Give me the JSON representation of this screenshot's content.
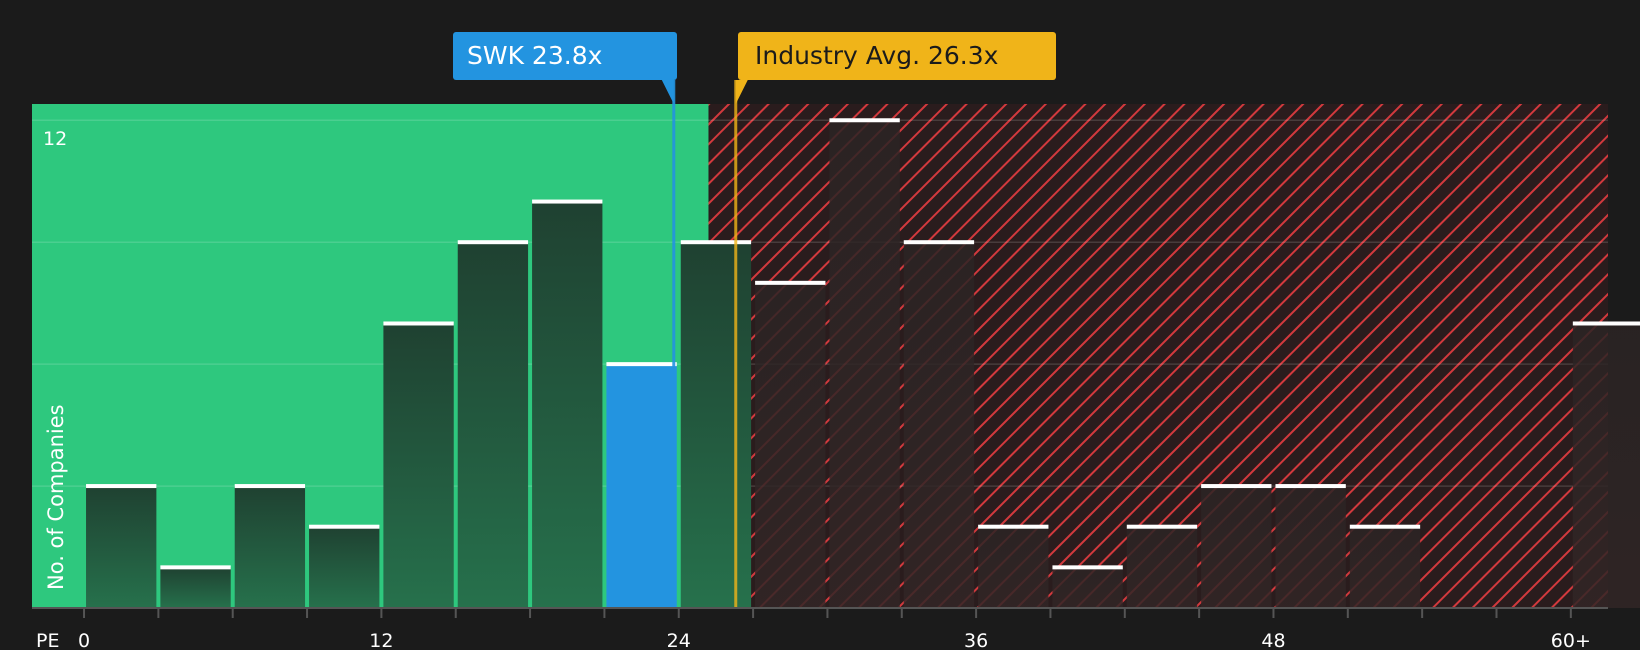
{
  "chart_data": {
    "type": "bar",
    "xlabel": "PE",
    "ylabel": "No. of Companies",
    "x_ticks": [
      "0",
      "12",
      "24",
      "36",
      "48",
      "60+"
    ],
    "y_ticks": [
      "12"
    ],
    "xlim": [
      -2.1,
      61.5
    ],
    "ylim": [
      0,
      12.4
    ],
    "bin_width": 3,
    "fair_value_max_pe": 25.2,
    "bins": [
      {
        "x0": 0,
        "value": 3
      },
      {
        "x0": 3,
        "value": 1
      },
      {
        "x0": 6,
        "value": 3
      },
      {
        "x0": 9,
        "value": 2
      },
      {
        "x0": 12,
        "value": 7
      },
      {
        "x0": 15,
        "value": 9
      },
      {
        "x0": 18,
        "value": 10
      },
      {
        "x0": 21,
        "value": 6,
        "highlight": true
      },
      {
        "x0": 24,
        "value": 9
      },
      {
        "x0": 27,
        "value": 8
      },
      {
        "x0": 30,
        "value": 12
      },
      {
        "x0": 33,
        "value": 9
      },
      {
        "x0": 36,
        "value": 2
      },
      {
        "x0": 39,
        "value": 1
      },
      {
        "x0": 42,
        "value": 2
      },
      {
        "x0": 45,
        "value": 3
      },
      {
        "x0": 48,
        "value": 3
      },
      {
        "x0": 51,
        "value": 2
      },
      {
        "x0": 60,
        "value": 7
      }
    ],
    "markers": [
      {
        "label": "SWK 23.8x",
        "value": 23.8,
        "color": "#2394e0"
      },
      {
        "label": "Industry Avg. 26.3x",
        "value": 26.3,
        "color": "#f0b419"
      }
    ],
    "colors": {
      "background": "#1b1b1b",
      "undervalued_zone": "#2ec87e",
      "overvalued_hatch": "#e0393e",
      "bar": "#1e4632",
      "highlight_bar": "#2394e0",
      "cap": "#ffffff"
    }
  }
}
